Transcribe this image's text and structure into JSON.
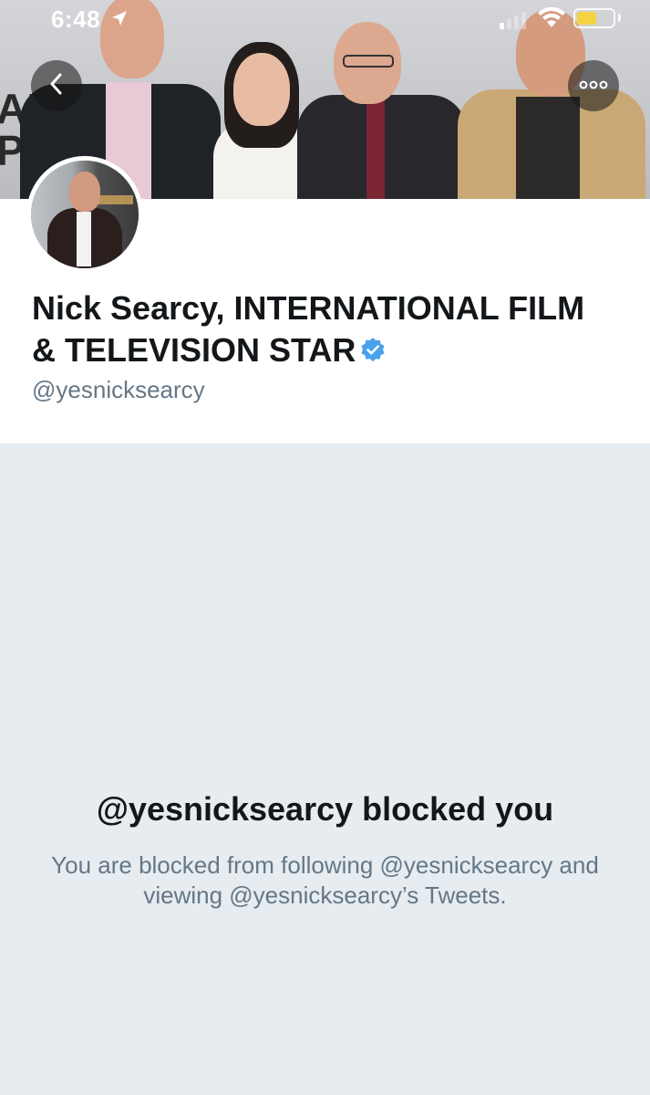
{
  "status_bar": {
    "time": "6:48",
    "battery_level": 0.55
  },
  "profile": {
    "name": "Nick Searcy, INTERNATIONAL FILM & TELEVISION STAR",
    "handle": "@yesnicksearcy",
    "verified": true
  },
  "blocked": {
    "title": "@yesnicksearcy blocked you",
    "description": "You are blocked from following @yesnicksearcy and viewing @yesnicksearcy’s Tweets."
  },
  "colors": {
    "verified_blue": "#4aa1ec",
    "text_primary": "#14171a",
    "text_secondary": "#657786",
    "background": "#e6ecf0",
    "battery": "#f5d33f"
  },
  "icons": {
    "back": "back-arrow-icon",
    "more": "more-options-icon",
    "location": "location-arrow-icon",
    "signal": "cellular-signal-icon",
    "wifi": "wifi-icon",
    "battery": "battery-icon",
    "verified": "verified-badge-icon"
  }
}
